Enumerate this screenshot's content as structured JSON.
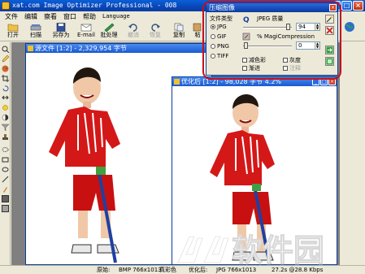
{
  "window": {
    "title": "xat.com  Image Optimizer Professional - 008",
    "minimize": "_",
    "maximize": "□",
    "close": "×"
  },
  "menu": [
    "文件",
    "编辑",
    "察看",
    "窗口",
    "帮助",
    "Language"
  ],
  "toolbar": {
    "open": "打开",
    "scan": "扫描",
    "save_as": "另存为",
    "email": "E-mail",
    "batch": "批处理",
    "undo": "撤消",
    "redo": "恢复",
    "copy": "复制",
    "paste": "粘"
  },
  "source_window": {
    "title": "源文件 [1:2] - 2,329,954 字节"
  },
  "optimized_window": {
    "title": "优化后 [1:2] - 98,028 字节 4.2%"
  },
  "dialog": {
    "title": "压缩图像",
    "file_type_label": "文件类型",
    "types": [
      "JPG",
      "GIF",
      "PNG",
      "TIFF"
    ],
    "selected_type": "JPG",
    "quality_label": "JPEG 质量",
    "quality_value": "94",
    "magic_label": "% MagiCompression",
    "magic_value": "0",
    "options": {
      "reduce_color": "减色彩",
      "grayscale": "灰度",
      "progressive": "渐进",
      "comment": "注释"
    }
  },
  "status": {
    "original_label": "原始:",
    "original_info": "BMP 766x1013",
    "original_color": "真彩色",
    "optimized_label": "优化后:",
    "optimized_info": "JPG 766x1013",
    "optimized_speed": "27.2s @28.8 Kbps"
  },
  "watermark": "软件园",
  "colors": {
    "titlebar": "#0a5fd8",
    "highlight": "#c4101c",
    "shirt": "#d41818"
  }
}
